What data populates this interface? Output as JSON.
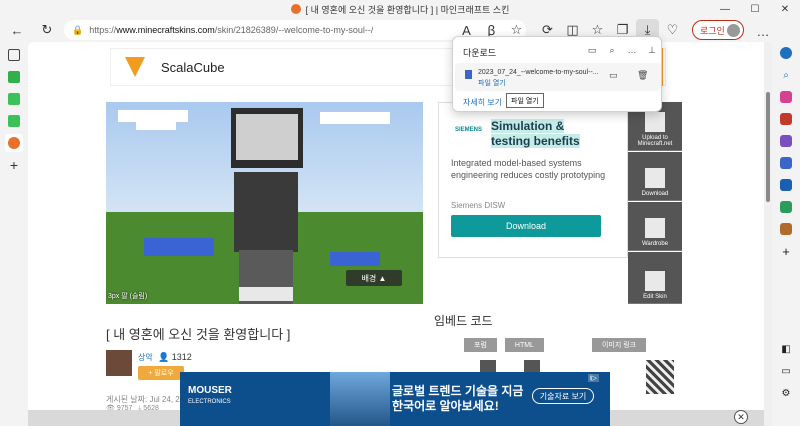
{
  "window": {
    "title": "[ 내 영혼에 오신 것을 환영합니다 ] | 마인크래프트 스킨",
    "minimize": "—",
    "maximize": "☐",
    "close": "✕"
  },
  "toolbar": {
    "url_prefix": "https://",
    "url_host": "www.minecraftskins.com",
    "url_path": "/skin/21826389/--welcome-to-my-soul--/",
    "login_label": "로그인"
  },
  "page": {
    "scalacube": "ScalaCube",
    "skin_caption": "3px 팔 (슬림)",
    "bg_button": "배경 ▲",
    "skin_title": "[ 내 영혼에 오신 것을 환영합니다 ]",
    "author_name": "상악",
    "author_count": "1312",
    "follow_label": "+ 팔로우",
    "posted": "게시된 날짜: Jul 24, 2023",
    "views": "9757",
    "downloads": "5628",
    "embed_title": "임베드 코드",
    "embed_tabs": [
      "포럼",
      "HTML",
      "이미지 링크"
    ]
  },
  "tools": [
    {
      "label": "Upload to Minecraft.net"
    },
    {
      "label": "Download"
    },
    {
      "label": "Wardrobe"
    },
    {
      "label": "Edit Skin"
    }
  ],
  "ad": {
    "brand_mark": "SIEMENS",
    "title_line1": "Simulation &",
    "title_line2": "testing benefits",
    "desc": "Integrated model-based systems engineering reduces costly prototyping",
    "brand": "Siemens DISW",
    "cta": "Download"
  },
  "bottom_ad": {
    "brand": "MOUSER",
    "brand_sub": "ELECTRONICS",
    "line1": "글로벌 트렌드 기술을 지금",
    "line2": "한국어로 알아보세요!",
    "cta": "기술자료 보기",
    "choice": "i▷"
  },
  "downloads": {
    "header": "다운로드",
    "file_name": "2023_07_24_--welcome-to-my-soul--...",
    "open_file": "파일 열기",
    "see_more": "자세히 보기",
    "tooltip": "파일 열기"
  },
  "colors": {
    "accent": "#0e9a9a",
    "login_red": "#c42b1c",
    "orange": "#f29c1f"
  }
}
